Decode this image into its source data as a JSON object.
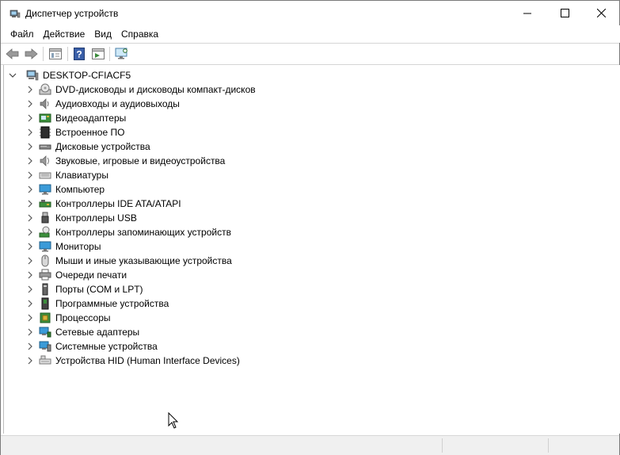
{
  "window": {
    "title": "Диспетчер устройств"
  },
  "menu": [
    "Файл",
    "Действие",
    "Вид",
    "Справка"
  ],
  "toolbar": [
    "back-icon",
    "forward-icon",
    "properties-icon",
    "help-icon",
    "view-icon",
    "monitor-scan-icon"
  ],
  "tree": {
    "root": "DESKTOP-CFIACF5",
    "items": [
      {
        "label": "DVD-дисководы и дисководы компакт-дисков",
        "icon": "dvd-drive-icon"
      },
      {
        "label": "Аудиовходы и аудиовыходы",
        "icon": "speaker-icon"
      },
      {
        "label": "Видеоадаптеры",
        "icon": "display-adapter-icon"
      },
      {
        "label": "Встроенное ПО",
        "icon": "firmware-icon"
      },
      {
        "label": "Дисковые устройства",
        "icon": "disk-drive-icon"
      },
      {
        "label": "Звуковые, игровые и видеоустройства",
        "icon": "sound-icon"
      },
      {
        "label": "Клавиатуры",
        "icon": "keyboard-icon"
      },
      {
        "label": "Компьютер",
        "icon": "computer-icon"
      },
      {
        "label": "Контроллеры IDE ATA/ATAPI",
        "icon": "ide-controller-icon"
      },
      {
        "label": "Контроллеры USB",
        "icon": "usb-icon"
      },
      {
        "label": "Контроллеры запоминающих устройств",
        "icon": "storage-controller-icon"
      },
      {
        "label": "Мониторы",
        "icon": "monitor-icon"
      },
      {
        "label": "Мыши и иные указывающие устройства",
        "icon": "mouse-icon"
      },
      {
        "label": "Очереди печати",
        "icon": "printer-icon"
      },
      {
        "label": "Порты (COM и LPT)",
        "icon": "port-icon"
      },
      {
        "label": "Программные устройства",
        "icon": "software-device-icon"
      },
      {
        "label": "Процессоры",
        "icon": "processor-icon"
      },
      {
        "label": "Сетевые адаптеры",
        "icon": "network-adapter-icon"
      },
      {
        "label": "Системные устройства",
        "icon": "system-device-icon"
      },
      {
        "label": "Устройства HID (Human Interface Devices)",
        "icon": "hid-icon"
      }
    ]
  }
}
